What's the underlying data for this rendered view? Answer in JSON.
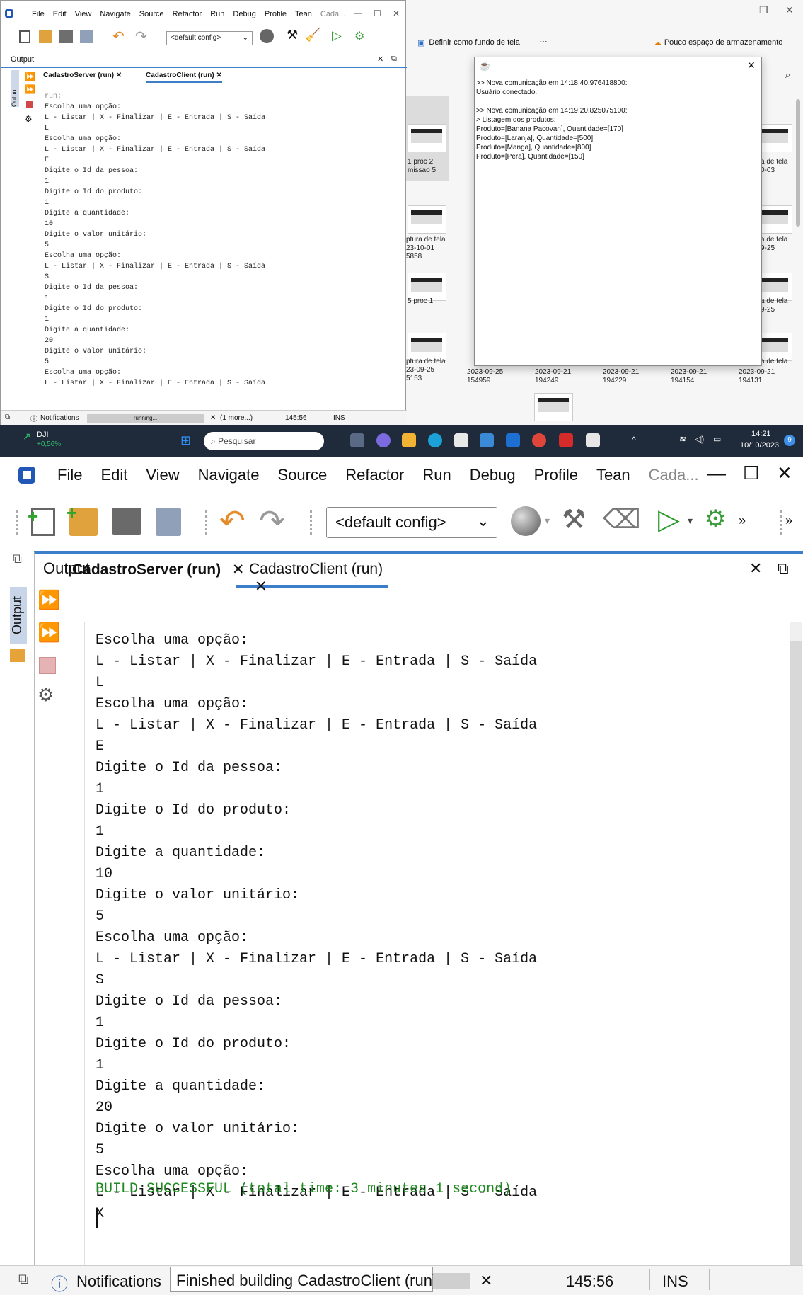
{
  "top": {
    "explorer": {
      "wallpaper_btn": "Definir como fundo de tela",
      "more": "···",
      "storage_warning": "Pouco espaço de armazenamento",
      "thumb_captions": [
        {
          "l1": "1 proc 2",
          "l2": "missao 5"
        },
        {
          "l1": "ptura de tela",
          "l2": "23-10-01",
          "l3": "5858"
        },
        {
          "l1": "5 proc 1"
        },
        {
          "l1": "ptura de tela",
          "l2": "23-09-25",
          "l3": "5153"
        },
        {
          "l1": "2023-09-25",
          "l2": "154959"
        },
        {
          "l1": "2023-09-21",
          "l2": "194249"
        },
        {
          "l1": "2023-09-21",
          "l2": "194229"
        },
        {
          "l1": "2023-09-21",
          "l2": "194154"
        },
        {
          "l1": "2023-09-21",
          "l2": "194131"
        },
        {
          "l1": "a de tela",
          "l2": "0-03"
        },
        {
          "l1": "a de tela",
          "l2": "9-25"
        },
        {
          "l1": "a de tela",
          "l2": "9-25"
        },
        {
          "l1": "a de tela"
        }
      ]
    },
    "netbeans_small": {
      "menu": [
        "File",
        "Edit",
        "View",
        "Navigate",
        "Source",
        "Refactor",
        "Run",
        "Debug",
        "Profile",
        "Tean",
        "Cada..."
      ],
      "config": "<default config>",
      "output_title": "Output",
      "tab1": "CadastroServer (run)",
      "tab2": "CadastroClient (run)",
      "lines": [
        "run:",
        "Escolha uma opção:",
        "L - Listar | X - Finalizar | E - Entrada | S - Saída",
        "L",
        "Escolha uma opção:",
        "L - Listar | X - Finalizar | E - Entrada | S - Saída",
        "E",
        "Digite o Id da pessoa:",
        "1",
        "Digite o Id do produto:",
        "1",
        "Digite a quantidade:",
        "10",
        "Digite o valor unitário:",
        "5",
        "Escolha uma opção:",
        "L - Listar | X - Finalizar | E - Entrada | S - Saída",
        "S",
        "Digite o Id da pessoa:",
        "1",
        "Digite o Id do produto:",
        "1",
        "Digite a quantidade:",
        "20",
        "Digite o valor unitário:",
        "5",
        "Escolha uma opção:",
        "L - Listar | X - Finalizar | E - Entrada | S - Saída"
      ],
      "status_notifications": "Notifications",
      "status_running": "running...",
      "status_more": "(1 more...)",
      "status_pos": "145:56",
      "status_ins": "INS"
    },
    "dialog": {
      "text": ">> Nova comunicação em 14:18:40.976418800:\nUsuário conectado.\n\n>> Nova comunicação em 14:19:20.825075100:\n> Listagem dos produtos:\nProduto=[Banana Pacovan], Quantidade=[170]\nProduto=[Laranja], Quantidade=[500]\nProduto=[Manga], Quantidade=[800]\nProduto=[Pera], Quantidade=[150]"
    },
    "taskbar": {
      "ticker": "DJI",
      "change": "+0,56%",
      "search": "Pesquisar",
      "time": "14:21",
      "date": "10/10/2023",
      "badge": "9"
    }
  },
  "big": {
    "menu": [
      "File",
      "Edit",
      "View",
      "Navigate",
      "Source",
      "Refactor",
      "Run",
      "Debug",
      "Profile",
      "Tean",
      "Cada..."
    ],
    "config": "<default config>",
    "output_title": "Output",
    "side_label": "Output",
    "tab1": "CadastroServer (run)",
    "tab2": "CadastroClient (run)",
    "lines": [
      "Escolha uma opção:",
      "L - Listar | X - Finalizar | E - Entrada | S - Saída",
      "L",
      "Escolha uma opção:",
      "L - Listar | X - Finalizar | E - Entrada | S - Saída",
      "E",
      "Digite o Id da pessoa:",
      "1",
      "Digite o Id do produto:",
      "1",
      "Digite a quantidade:",
      "10",
      "Digite o valor unitário:",
      "5",
      "Escolha uma opção:",
      "L - Listar | X - Finalizar | E - Entrada | S - Saída",
      "S",
      "Digite o Id da pessoa:",
      "1",
      "Digite o Id do produto:",
      "1",
      "Digite a quantidade:",
      "20",
      "Digite o valor unitário:",
      "5",
      "Escolha uma opção:",
      "L - Listar | X - Finalizar | E - Entrada | S - Saída",
      "X"
    ],
    "build": "BUILD SUCCESSFUL (total time: 3 minutes 1 second)",
    "status_notifications": "Notifications",
    "status_msg": "Finished building CadastroClient (run).",
    "status_pos": "145:56",
    "status_ins": "INS",
    "colors": {
      "accent": "#3c7ec9",
      "build": "#1f8a1f"
    }
  }
}
